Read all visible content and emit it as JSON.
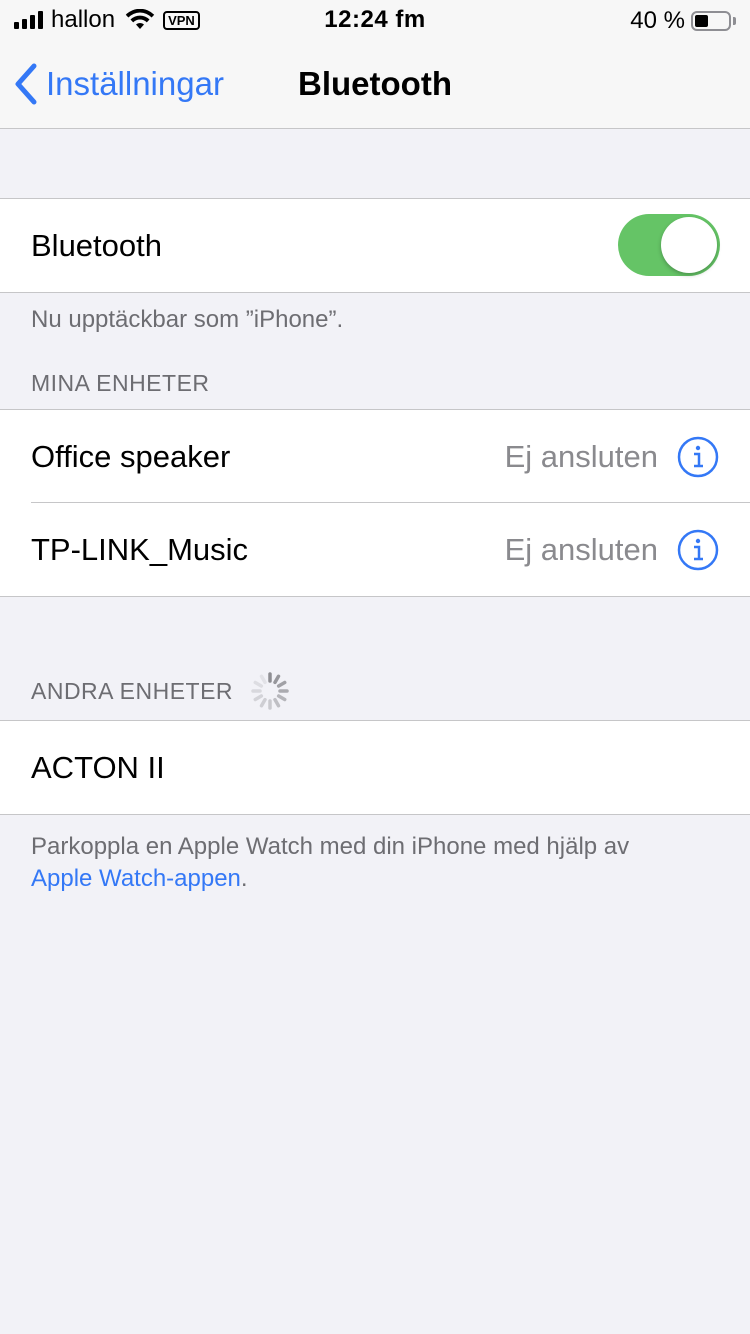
{
  "status_bar": {
    "carrier": "hallon",
    "vpn_label": "VPN",
    "time": "12:24 fm",
    "battery_percent": "40 %",
    "battery_level": 0.4
  },
  "nav": {
    "back_label": "Inställningar",
    "title": "Bluetooth"
  },
  "bluetooth_toggle": {
    "label": "Bluetooth",
    "on": true,
    "color": "#65c466"
  },
  "discoverable_text": "Nu upptäckbar som ”iPhone”.",
  "my_devices": {
    "header": "MINA ENHETER",
    "items": [
      {
        "name": "Office speaker",
        "status": "Ej ansluten"
      },
      {
        "name": "TP-LINK_Music",
        "status": "Ej ansluten"
      }
    ]
  },
  "other_devices": {
    "header": "ANDRA ENHETER",
    "items": [
      {
        "name": "ACTON II"
      }
    ]
  },
  "footer": {
    "text": "Parkoppla en Apple Watch med din iPhone med hjälp av",
    "link": "Apple Watch-appen",
    "suffix": "."
  },
  "colors": {
    "accent": "#3478f6",
    "toggle_on": "#65c466"
  }
}
